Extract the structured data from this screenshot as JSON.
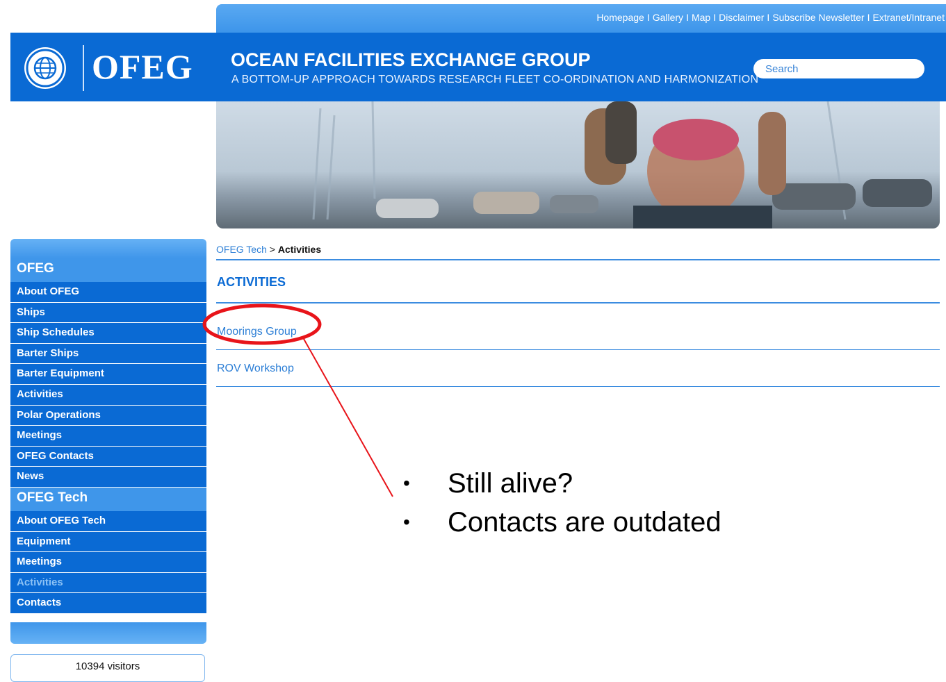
{
  "topnav": {
    "links": [
      "Homepage",
      "Gallery",
      "Map",
      "Disclaimer",
      "Subscribe Newsletter",
      "Extranet/Intranet"
    ],
    "separator": "I"
  },
  "header": {
    "logo_text": "OFEG",
    "title": "OCEAN FACILITIES EXCHANGE GROUP",
    "subtitle": "A BOTTOM-UP APPROACH TOWARDS RESEARCH FLEET CO-ORDINATION AND HARMONIZATION",
    "search_placeholder": "Search"
  },
  "sidebar": {
    "section1": "OFEG",
    "items1": [
      "About OFEG",
      "Ships",
      "Ship Schedules",
      "Barter Ships",
      "Barter Equipment",
      "Activities",
      "Polar Operations",
      "Meetings",
      "OFEG Contacts",
      "News"
    ],
    "section2": "OFEG Tech",
    "items2": [
      "About OFEG Tech",
      "Equipment",
      "Meetings",
      "Activities",
      "Contacts"
    ],
    "active_item": "Activities"
  },
  "visitors": "10394 visitors",
  "breadcrumb": {
    "parent": "OFEG Tech",
    "sep": ">",
    "current": "Activities"
  },
  "main": {
    "heading": "ACTIVITIES",
    "links": [
      "Moorings Group",
      "ROV Workshop"
    ]
  },
  "annotation": {
    "bullet": "•",
    "notes": [
      "Still alive?",
      "Contacts are outdated"
    ],
    "color": "#e8141a"
  }
}
